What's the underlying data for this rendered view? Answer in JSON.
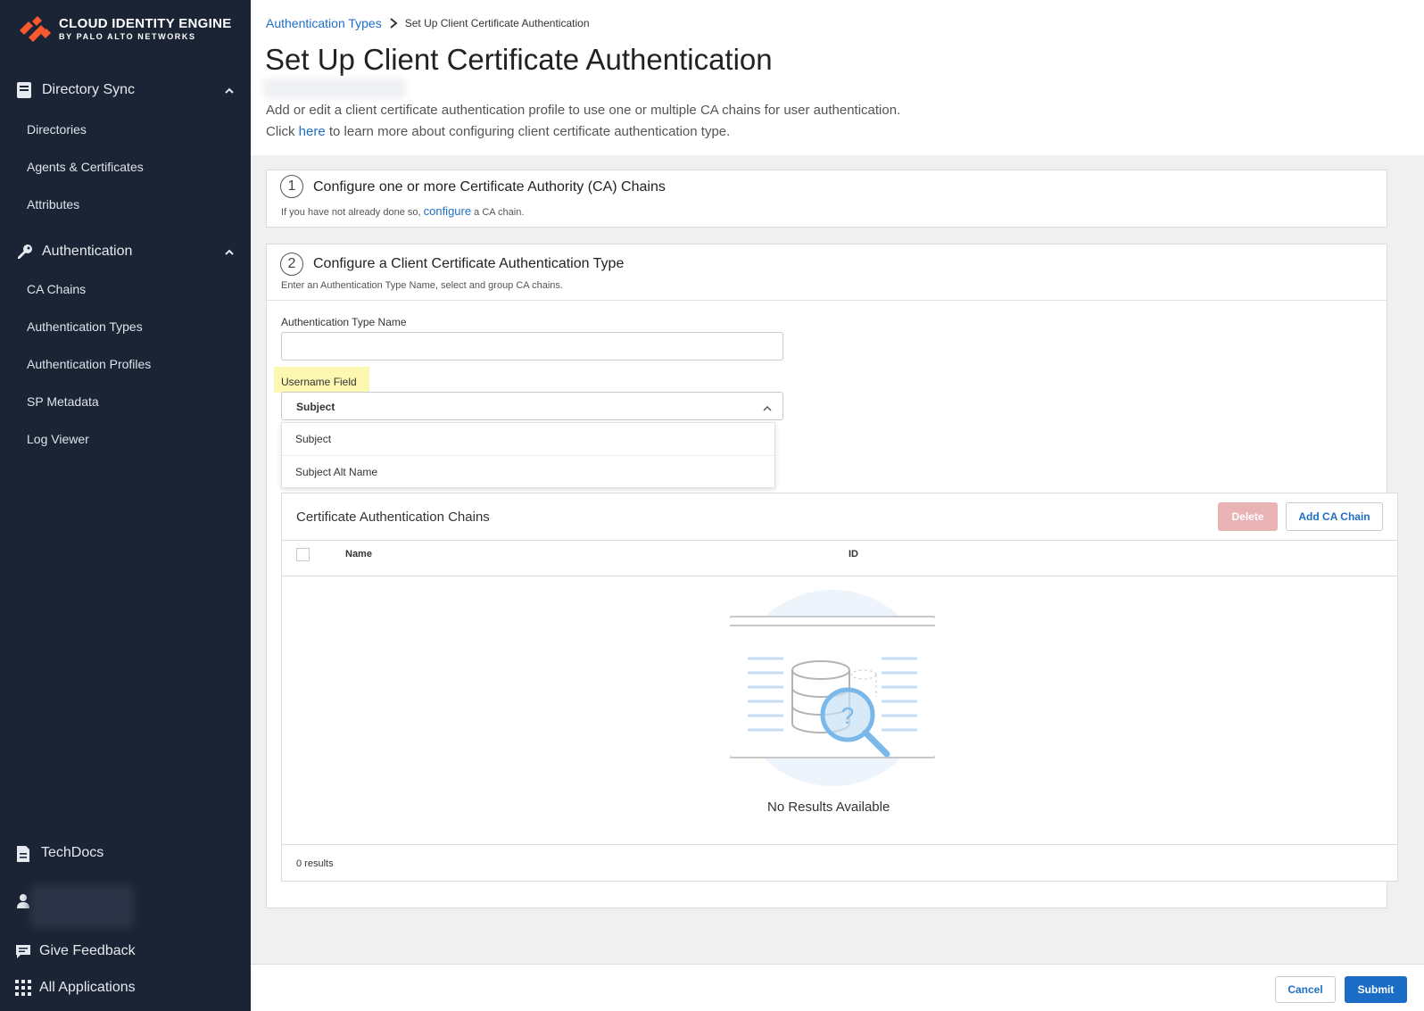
{
  "brand": {
    "title": "CLOUD IDENTITY ENGINE",
    "subtitle": "BY PALO ALTO NETWORKS",
    "accent": "#fa582d"
  },
  "sidebar": {
    "sections": [
      {
        "label": "Directory Sync",
        "icon": "book-icon",
        "expanded": true,
        "items": [
          {
            "label": "Directories"
          },
          {
            "label": "Agents & Certificates"
          },
          {
            "label": "Attributes"
          }
        ]
      },
      {
        "label": "Authentication",
        "icon": "key-icon",
        "expanded": true,
        "items": [
          {
            "label": "CA Chains"
          },
          {
            "label": "Authentication Types"
          },
          {
            "label": "Authentication Profiles"
          },
          {
            "label": "SP Metadata"
          },
          {
            "label": "Log Viewer"
          }
        ]
      }
    ],
    "bottom": {
      "techdocs": "TechDocs",
      "feedback": "Give Feedback",
      "apps": "All Applications"
    }
  },
  "breadcrumb": {
    "parent": "Authentication Types",
    "current": "Set Up Client Certificate Authentication"
  },
  "page": {
    "title": "Set Up Client Certificate Authentication",
    "desc_line1": "Add or edit a client certificate authentication profile to use one or multiple CA chains for user authentication.",
    "desc_line2_prefix": "Click ",
    "desc_line2_link": "here",
    "desc_line2_suffix": " to learn more about configuring client certificate authentication type."
  },
  "step1": {
    "number": "1",
    "title": "Configure one or more Certificate Authority (CA) Chains",
    "sub_prefix": "If you have not already done so, ",
    "sub_link": "configure",
    "sub_suffix": " a CA chain."
  },
  "step2": {
    "number": "2",
    "title": "Configure a Client Certificate Authentication Type",
    "sub": "Enter an Authentication Type Name, select and group CA chains.",
    "name_label": "Authentication Type Name",
    "name_value": "",
    "username_label": "Username Field",
    "username_selected": "Subject",
    "username_options": [
      "Subject",
      "Subject Alt Name"
    ]
  },
  "chains_table": {
    "title": "Certificate Authentication Chains",
    "delete_label": "Delete",
    "add_label": "Add CA Chain",
    "columns": [
      "Name",
      "ID"
    ],
    "rows": [],
    "empty_text": "No Results Available",
    "results_text": "0 results"
  },
  "footer": {
    "cancel": "Cancel",
    "submit": "Submit"
  }
}
